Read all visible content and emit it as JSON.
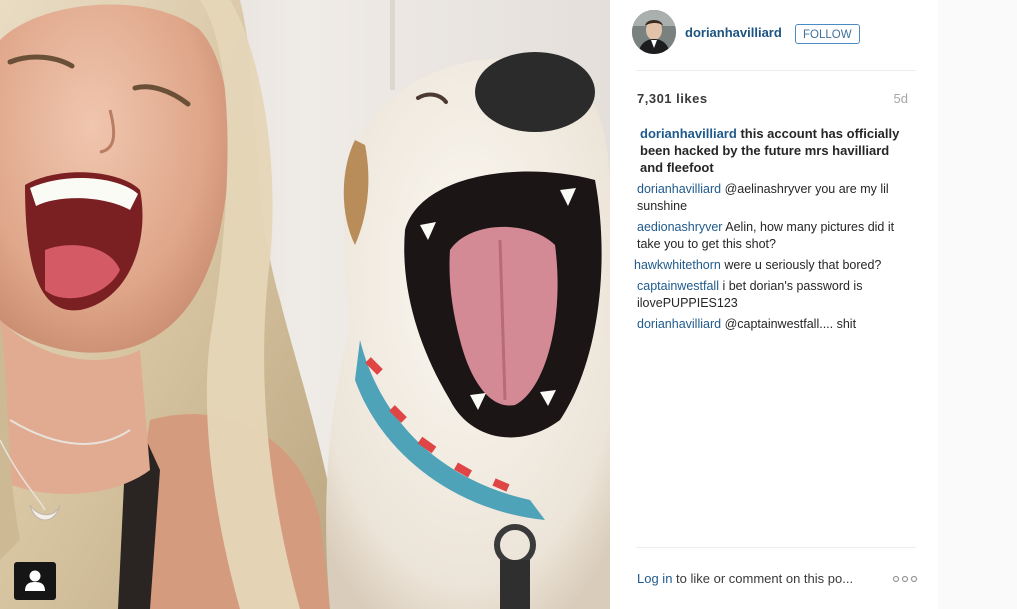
{
  "post": {
    "username": "dorianhavilliard",
    "follow_label": "FOLLOW",
    "likes": "7,301 likes",
    "time_ago": "5d"
  },
  "caption": {
    "username": "dorianhavilliard",
    "text": "this account has officially been hacked by the future mrs havilliard and fleefoot"
  },
  "comments": [
    {
      "username": "dorianhavilliard",
      "text": "@aelinashryver you are my lil sunshine"
    },
    {
      "username": "aedionashryver",
      "text": "Aelin, how many pictures did it take you to get this shot?"
    },
    {
      "username": "hawkwhitethorn",
      "text": "were u seriously that bored?"
    },
    {
      "username": "captainwestfall",
      "text": "i bet dorian's password is ilovePUPPIES123"
    },
    {
      "username": "dorianhavilliard",
      "text": "@captainwestfall.... shit"
    }
  ],
  "footer": {
    "login_link": "Log in",
    "login_text": "to like or comment on this po...",
    "more_icon": "ellipsis-icon"
  },
  "photo": {
    "user_tag_icon": "person-icon"
  },
  "colors": {
    "link": "#1f5a8c",
    "follow_border": "#4b8bc4",
    "muted": "#a5a7aa"
  }
}
